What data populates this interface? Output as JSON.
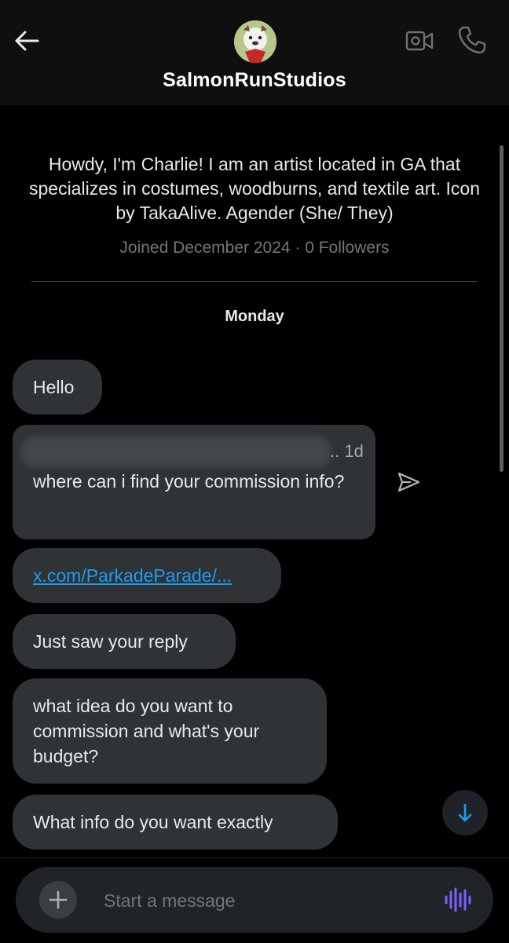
{
  "header": {
    "username": "SalmonRunStudios",
    "back_icon": "arrow-left-icon",
    "video_icon": "video-camera-icon",
    "phone_icon": "phone-icon"
  },
  "profile": {
    "bio": "Howdy, I'm Charlie! I am an artist located in GA that specializes in costumes, woodburns, and textile art. Icon by TakaAlive. Agender (She/ They)",
    "meta": "Joined December 2024 · 0 Followers"
  },
  "conversation": {
    "day_label": "Monday",
    "messages": [
      {
        "text": "Hello"
      },
      {
        "quoted_time": ".. 1d",
        "text": "where can i find your commission info?"
      },
      {
        "text": "x.com/ParkadeParade/..."
      },
      {
        "text": "Just saw your reply"
      },
      {
        "text": "what idea do you want to commission and what's your budget?"
      },
      {
        "text": "What info do you want exactly"
      }
    ]
  },
  "composer": {
    "placeholder": "Start a message"
  },
  "colors": {
    "background": "#000000",
    "bubble": "#2f3336",
    "link": "#1d9bf0",
    "voice_accent": "#7b61ff",
    "jump_arrow": "#1d9bf0"
  }
}
